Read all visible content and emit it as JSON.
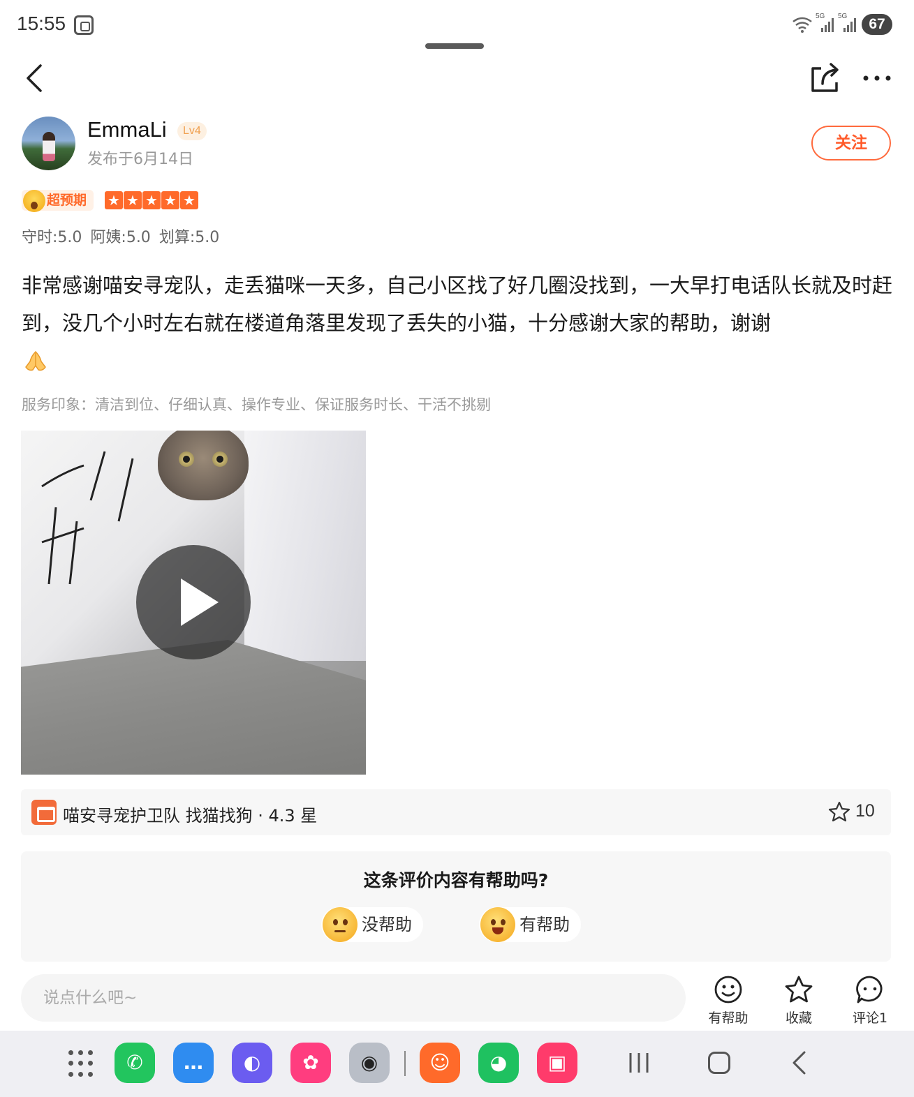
{
  "status_bar": {
    "time": "15:55",
    "battery": "67",
    "signal_labels": [
      "5G",
      "5G"
    ]
  },
  "nav": {
    "back_icon": "chevron-left-icon",
    "share_icon": "share-icon",
    "more_icon": "more-horizontal-icon"
  },
  "author": {
    "name": "EmmaLi",
    "level": "Lv4",
    "posted": "发布于6月14日",
    "follow_label": "关注"
  },
  "rating": {
    "badge": "超预期",
    "stars": 5,
    "star_glyph": "★",
    "scores": [
      "守时:5.0",
      "阿姨:5.0",
      "划算:5.0"
    ]
  },
  "review": {
    "text": "非常感谢喵安寻宠队，走丢猫咪一天多，自己小区找了好几圈没找到，一大早打电话队长就及时赶到，没几个小时左右就在楼道角落里发现了丢失的小猫，十分感谢大家的帮助，谢谢",
    "emoji": "folded-hands-icon",
    "impression": "服务印象：清洁到位、仔细认真、操作专业、保证服务时长、干活不挑剔"
  },
  "media": {
    "type": "video",
    "play_icon": "play-icon"
  },
  "shop": {
    "name": "喵安寻宠护卫队 找猫找狗 · 4.3 星",
    "favorites": "10"
  },
  "helpful_panel": {
    "question": "这条评价内容有帮助吗?",
    "not_helpful": "没帮助",
    "helpful": "有帮助"
  },
  "action_bar": {
    "placeholder": "说点什么吧~",
    "helpful_label": "有帮助",
    "favorite_label": "收藏",
    "comment_label": "评论1"
  },
  "dock": {
    "apps": [
      {
        "name": "phone",
        "color": "#22c55e",
        "glyph": "✆"
      },
      {
        "name": "messages",
        "color": "#2f8cf0",
        "glyph": "…"
      },
      {
        "name": "browser",
        "color": "#6b5cf0",
        "glyph": "◐"
      },
      {
        "name": "gallery",
        "color": "#ff3d7f",
        "glyph": "✿"
      },
      {
        "name": "camera",
        "color": "#b9bec7",
        "glyph": "◉"
      },
      {
        "name": "dianping",
        "color": "#ff6a2a",
        "glyph": "☺"
      },
      {
        "name": "wechat",
        "color": "#1fc160",
        "glyph": "◕"
      },
      {
        "name": "store",
        "color": "#ff3b6b",
        "glyph": "▣"
      }
    ]
  },
  "colors": {
    "accent": "#ff6a2a",
    "panel_bg": "#f7f7f7"
  }
}
